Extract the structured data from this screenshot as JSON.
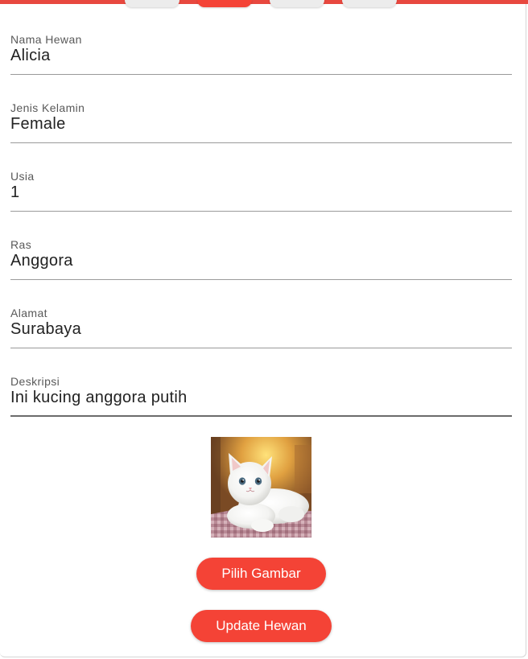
{
  "form": {
    "fields": [
      {
        "label": "Nama Hewan",
        "value": "Alicia"
      },
      {
        "label": "Jenis Kelamin",
        "value": "Female"
      },
      {
        "label": "Usia",
        "value": "1"
      },
      {
        "label": "Ras",
        "value": "Anggora"
      },
      {
        "label": "Alamat",
        "value": "Surabaya"
      },
      {
        "label": "Deskripsi",
        "value": "Ini kucing anggora putih"
      }
    ]
  },
  "image": {
    "icon": "white-cat-photo"
  },
  "buttons": {
    "pick_image": "Pilih Gambar",
    "update": "Update Hewan"
  },
  "colors": {
    "accent": "#f44336",
    "text": "#222222",
    "label": "#595959"
  }
}
